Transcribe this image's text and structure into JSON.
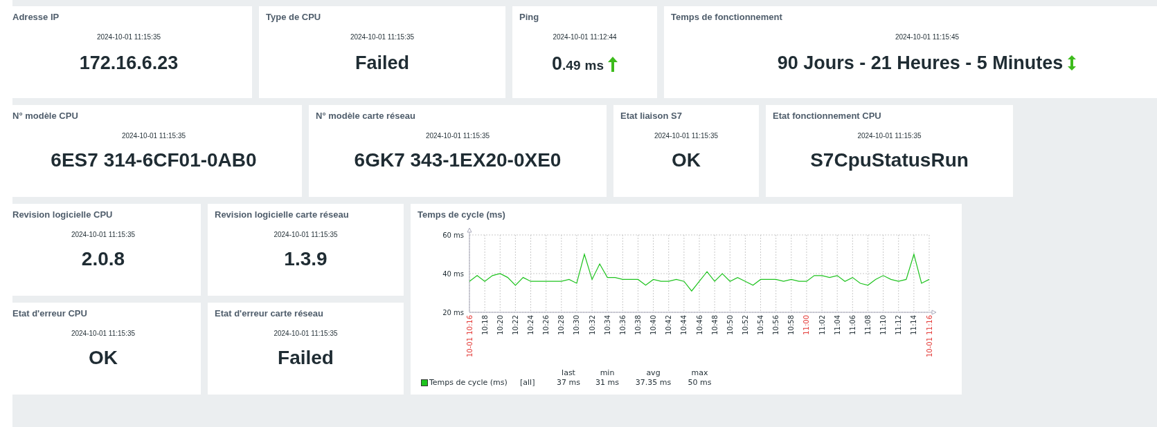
{
  "row_1": [
    {
      "kind": "plain",
      "title": "Adresse IP",
      "time": "2024-10-01 11:15:35",
      "value": "172.16.6.23"
    },
    {
      "kind": "plain",
      "title": "Type de CPU",
      "time": "2024-10-01 11:15:35",
      "value": "Failed"
    },
    {
      "kind": "rising",
      "title": "Ping",
      "time": "2024-10-01 11:12:44",
      "value": "0",
      "value_decimals": ".49",
      "units": "ms"
    },
    {
      "kind": "changed",
      "title": "Temps de fonctionnement",
      "time": "2024-10-01 11:15:45",
      "value": "90 Jours - 21 Heures - 5 Minutes"
    }
  ],
  "row_2": [
    {
      "title": "N° modèle CPU",
      "time": "2024-10-01 11:15:35",
      "value": "6ES7 314-6CF01-0AB0"
    },
    {
      "title": "N° modèle carte réseau",
      "time": "2024-10-01 11:15:35",
      "value": "6GK7 343-1EX20-0XE0"
    },
    {
      "title": "Etat liaison S7",
      "time": "2024-10-01 11:15:35",
      "value": "OK"
    },
    {
      "title": "Etat fonctionnement CPU",
      "time": "2024-10-01 11:15:35",
      "value": "S7CpuStatusRun"
    }
  ],
  "row_3": [
    {
      "title": "Revision logicielle CPU",
      "time": "2024-10-01 11:15:35",
      "value": "2.0.8"
    },
    {
      "title": "Revision logicielle carte réseau",
      "time": "2024-10-01 11:15:35",
      "value": "1.3.9"
    },
    {
      "title": "Etat d'erreur CPU",
      "time": "2024-10-01 11:15:35",
      "value": "OK"
    },
    {
      "title": "Etat d'erreur carte réseau",
      "time": "2024-10-01 11:15:35",
      "value": "Failed"
    }
  ],
  "chart": {
    "title": "Temps de cycle (ms)",
    "chart_data": {
      "type": "line",
      "grid": true,
      "x": [
        616,
        617,
        618,
        619,
        620,
        621,
        622,
        623,
        624,
        625,
        626,
        627,
        628,
        629,
        630,
        631,
        632,
        633,
        634,
        635,
        636,
        637,
        638,
        639,
        640,
        641,
        642,
        643,
        644,
        645,
        646,
        647,
        648,
        649,
        650,
        651,
        652,
        653,
        654,
        655,
        656,
        657,
        658,
        659,
        660,
        661,
        662,
        663,
        664,
        665,
        666,
        667,
        668,
        669,
        670,
        671,
        672,
        673,
        674,
        675,
        676
      ],
      "xlim": [
        616,
        676
      ],
      "series": [
        {
          "name": "Temps de cycle (ms)",
          "color": "#1ec31e",
          "values": [
            36,
            39,
            36,
            39,
            40,
            38,
            34,
            38,
            36,
            36,
            36,
            36,
            36,
            37,
            35,
            50,
            37,
            45,
            38,
            38,
            37,
            37,
            37,
            34,
            37,
            36,
            36,
            37,
            36,
            31,
            36,
            41,
            36,
            40,
            36,
            38,
            36,
            34,
            37,
            37,
            37,
            36,
            37,
            36,
            36,
            39,
            39,
            38,
            39,
            36,
            38,
            35,
            34,
            37,
            39,
            37,
            36,
            37,
            50,
            35,
            37
          ]
        }
      ],
      "ylim": [
        20,
        60
      ],
      "yticks": [
        {
          "value": 20,
          "label": "20 ms"
        },
        {
          "value": 40,
          "label": "40 ms"
        },
        {
          "value": 60,
          "label": "60 ms"
        }
      ],
      "xticks": [
        {
          "value": 616,
          "label": "10-01 10:16"
        },
        {
          "value": 618,
          "label": "10:18"
        },
        {
          "value": 620,
          "label": "10:20"
        },
        {
          "value": 622,
          "label": "10:22"
        },
        {
          "value": 624,
          "label": "10:24"
        },
        {
          "value": 626,
          "label": "10:26"
        },
        {
          "value": 628,
          "label": "10:28"
        },
        {
          "value": 630,
          "label": "10:30"
        },
        {
          "value": 632,
          "label": "10:32"
        },
        {
          "value": 634,
          "label": "10:34"
        },
        {
          "value": 636,
          "label": "10:36"
        },
        {
          "value": 638,
          "label": "10:38"
        },
        {
          "value": 640,
          "label": "10:40"
        },
        {
          "value": 642,
          "label": "10:42"
        },
        {
          "value": 644,
          "label": "10:44"
        },
        {
          "value": 646,
          "label": "10:46"
        },
        {
          "value": 648,
          "label": "10:48"
        },
        {
          "value": 650,
          "label": "10:50"
        },
        {
          "value": 652,
          "label": "10:52"
        },
        {
          "value": 654,
          "label": "10:54"
        },
        {
          "value": 656,
          "label": "10:56"
        },
        {
          "value": 658,
          "label": "10:58"
        },
        {
          "value": 660,
          "label": "11:00"
        },
        {
          "value": 662,
          "label": "11:02"
        },
        {
          "value": 664,
          "label": "11:04"
        },
        {
          "value": 666,
          "label": "11:06"
        },
        {
          "value": 668,
          "label": "11:08"
        },
        {
          "value": 670,
          "label": "11:10"
        },
        {
          "value": 672,
          "label": "11:12"
        },
        {
          "value": 674,
          "label": "11:14"
        },
        {
          "value": 676,
          "label": "10-01 11:16"
        }
      ]
    },
    "legend": {
      "scope": "[all]",
      "columns": [
        {
          "header": "last",
          "value": "37 ms"
        },
        {
          "header": "min",
          "value": "31 ms"
        },
        {
          "header": "avg",
          "value": "37.35 ms"
        },
        {
          "header": "max",
          "value": "50 ms"
        }
      ]
    }
  }
}
